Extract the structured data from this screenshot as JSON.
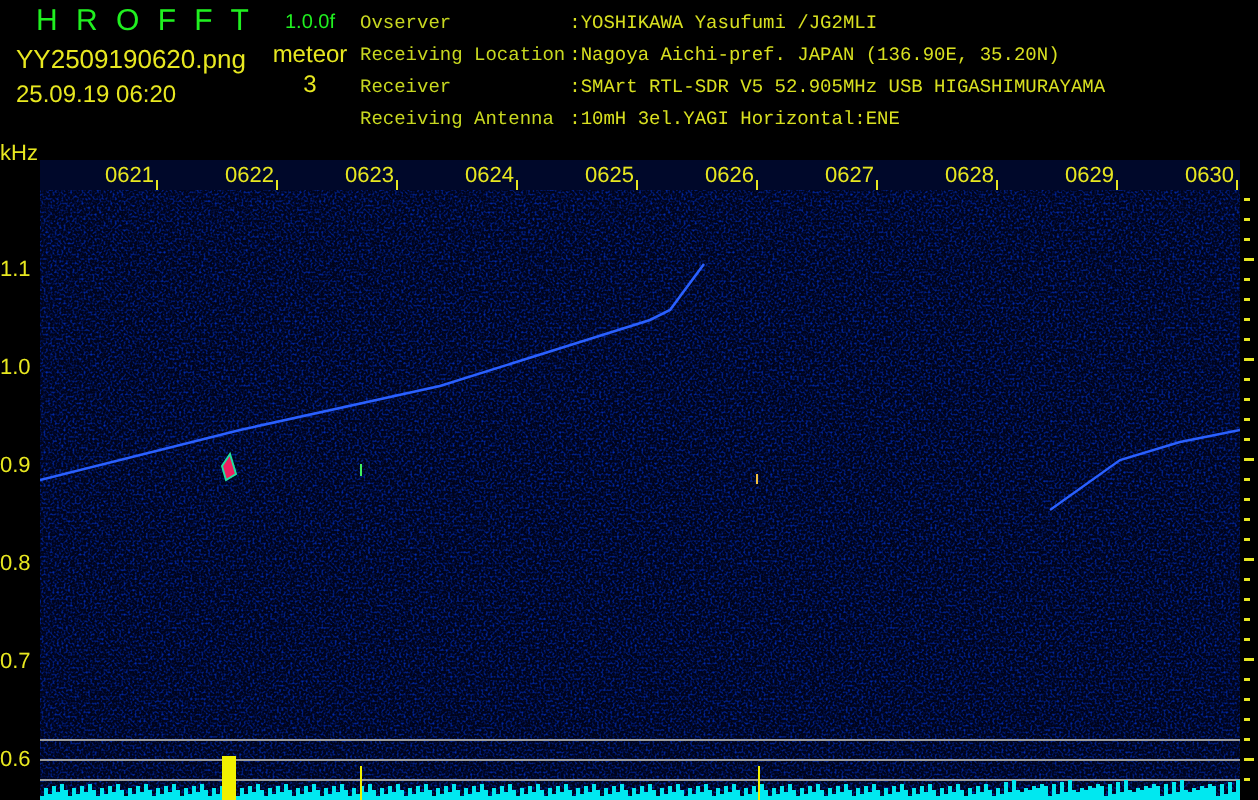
{
  "app": {
    "title": "H R O F F T",
    "version": "1.0.0f",
    "file_name": "YY2509190620.png",
    "timestamp": "25.09.19 06:20",
    "counter_label": "meteor",
    "counter_value": "3"
  },
  "station_info": [
    {
      "label": "Ovserver",
      "value": ":YOSHIKAWA Yasufumi /JG2MLI"
    },
    {
      "label": "Receiving Location",
      "value": ":Nagoya Aichi-pref. JAPAN (136.90E, 35.20N)"
    },
    {
      "label": "Receiver",
      "value": ":SMArt RTL-SDR V5 52.905MHz USB HIGASHIMURAYAMA"
    },
    {
      "label": "Receiving Antenna",
      "value": ":10mH 3el.YAGI Horizontal:ENE"
    }
  ],
  "frequency_axis": {
    "unit": "kHz",
    "labels": [
      "1.1",
      "1.0",
      "0.9",
      "0.8",
      "0.7",
      "0.6"
    ]
  },
  "time_axis": {
    "labels": [
      "0621",
      "0622",
      "0623",
      "0624",
      "0625",
      "0626",
      "0627",
      "0628",
      "0629",
      "0630"
    ]
  }
}
